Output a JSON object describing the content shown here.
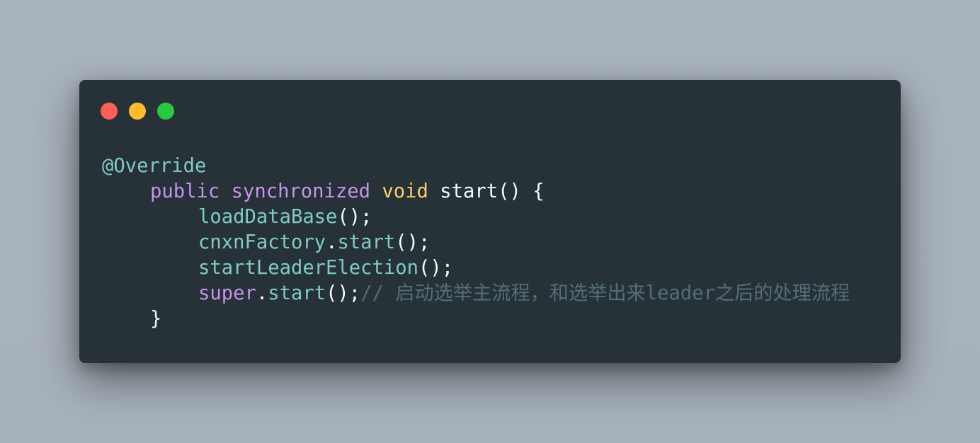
{
  "window": {
    "controls": {
      "close_color": "#ff5f56",
      "minimize_color": "#ffbd2e",
      "maximize_color": "#27c93f"
    }
  },
  "code": {
    "line1": {
      "annotation": "@Override"
    },
    "line2": {
      "kw_public": "public",
      "kw_synchronized": "synchronized",
      "type_void": "void",
      "method": "start() {"
    },
    "line3": {
      "call": "loadDataBase",
      "tail": "();"
    },
    "line4": {
      "object": "cnxnFactory",
      "dot": ".",
      "call": "start",
      "tail": "();"
    },
    "line5": {
      "call": "startLeaderElection",
      "tail": "();"
    },
    "line6": {
      "kw_super": "super",
      "dot": ".",
      "call": "start",
      "tail": "();",
      "comment": "// 启动选举主流程，和选举出来leader之后的处理流程"
    },
    "line7": {
      "brace": "}"
    }
  },
  "colors": {
    "background": "#a9b3bd",
    "editor_bg": "#263238",
    "annotation": "#80cbc4",
    "keyword": "#c792ea",
    "type": "#ffcb6b",
    "text": "#eeffff",
    "comment": "#546e7a"
  }
}
